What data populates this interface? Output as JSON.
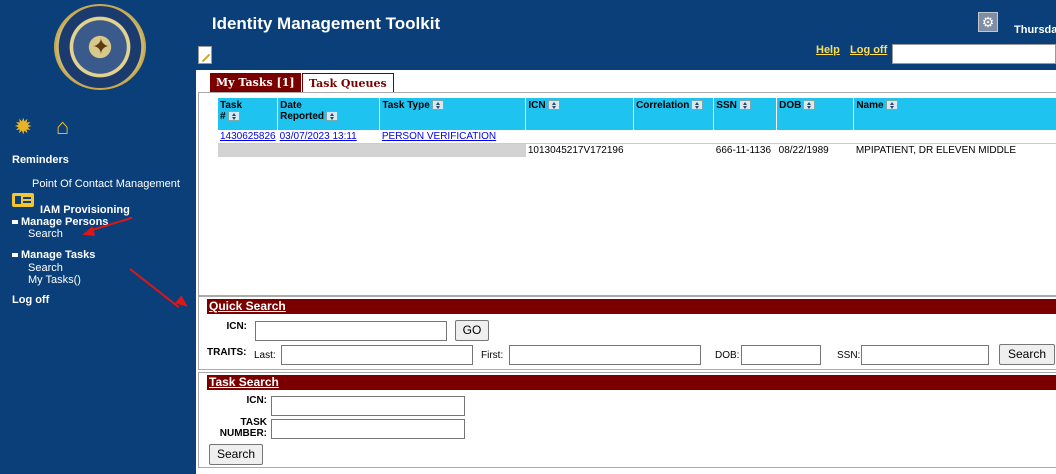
{
  "header": {
    "title": "Identity Management Toolkit",
    "day_text": "Thursda",
    "help_label": "Help",
    "logoff_label": "Log off"
  },
  "sidebar": {
    "reminders": "Reminders",
    "poc": "Point Of Contact Management",
    "iam": "IAM Provisioning",
    "manage_persons": "Manage Persons",
    "persons_search": "Search",
    "manage_tasks": "Manage Tasks",
    "tasks_search": "Search",
    "my_tasks": "My Tasks()",
    "logoff": "Log off"
  },
  "tabs": {
    "my_tasks": "My Tasks [1]",
    "task_queues": "Task Queues"
  },
  "table": {
    "columns": {
      "task_num_1": "Task",
      "task_num_2": "#",
      "date_1": "Date",
      "date_2": "Reported",
      "task_type": "Task Type",
      "icn": "ICN",
      "correlation": "Correlation",
      "ssn": "SSN",
      "dob": "DOB",
      "name": "Name"
    },
    "row": {
      "task_number": "1430625826",
      "date_reported": "03/07/2023 13:11",
      "task_type": "PERSON VERIFICATION",
      "icn": "1013045217V172196",
      "correlation": "",
      "ssn": "666-11-1136",
      "dob": "08/22/1989",
      "name": "MPIPATIENT, DR ELEVEN MIDDLE"
    }
  },
  "quick_search": {
    "title": "Quick Search",
    "icn_label": "ICN:",
    "go_label": "GO",
    "traits_label": "TRAITS:",
    "last_label": "Last:",
    "first_label": "First:",
    "dob_label": "DOB:",
    "ssn_label": "SSN:",
    "search_label": "Search"
  },
  "task_search": {
    "title": "Task Search",
    "icn_label": "ICN:",
    "task_label_1": "TASK",
    "task_label_2": "NUMBER:",
    "search_label": "Search"
  },
  "colors": {
    "brand_blue": "#0a3f7a",
    "header_maroon": "#7a0000",
    "grid_header_cyan": "#1ec3f0",
    "annotation_red": "#e01515"
  },
  "icons": [
    "va-seal-logo",
    "gear-icon",
    "home-icon",
    "id-card-icon",
    "notepad-icon",
    "sort-icon"
  ]
}
